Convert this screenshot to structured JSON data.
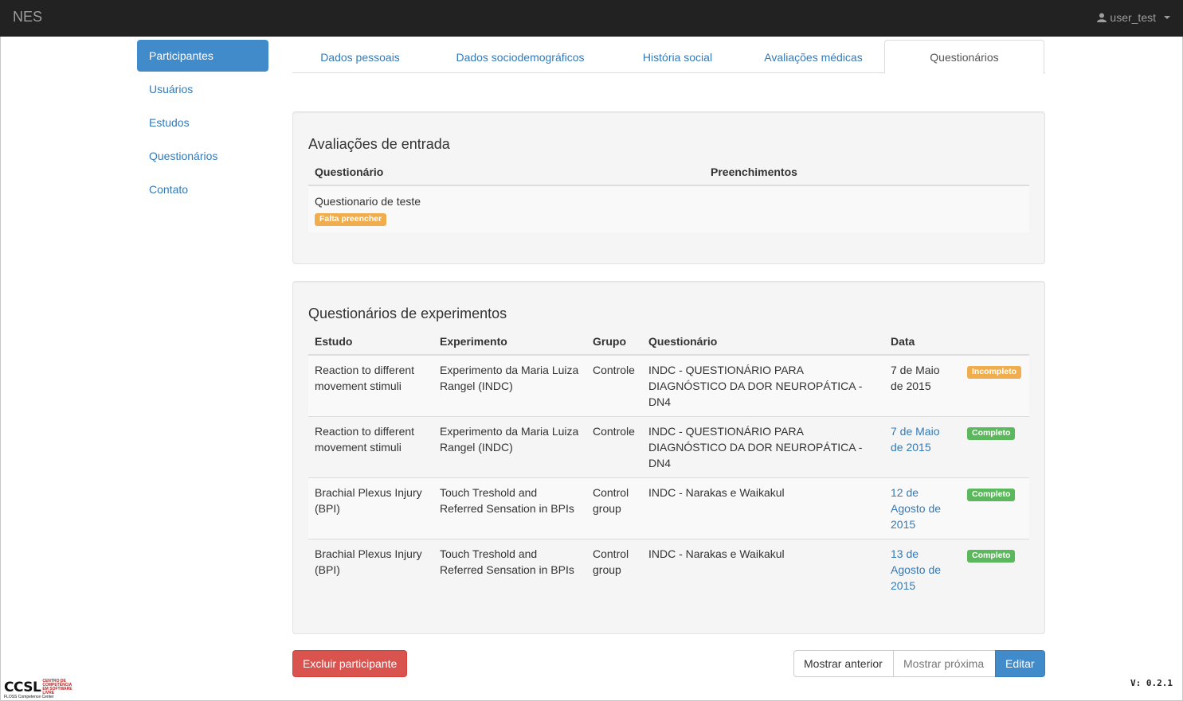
{
  "navbar": {
    "brand": "NES",
    "user": "user_test"
  },
  "sidebar": {
    "items": [
      "Participantes",
      "Usuários",
      "Estudos",
      "Questionários",
      "Contato"
    ]
  },
  "tabs": [
    "Dados pessoais",
    "Dados sociodemográficos",
    "História social",
    "Avaliações médicas",
    "Questionários"
  ],
  "entry": {
    "title": "Avaliações de entrada",
    "headers": [
      "Questionário",
      "Preenchimentos"
    ],
    "row": {
      "name": "Questionario de teste",
      "badge": "Falta preencher"
    }
  },
  "experiments": {
    "title": "Questionários de experimentos",
    "headers": [
      "Estudo",
      "Experimento",
      "Grupo",
      "Questionário",
      "Data"
    ],
    "rows": [
      {
        "estudo": "Reaction to different movement stimuli",
        "experimento": "Experimento da Maria Luiza Rangel (INDC)",
        "grupo": "Controle",
        "questionario": "INDC - QUESTIONÁRIO PARA DIAGNÓSTICO DA DOR NEUROPÁTICA - DN4",
        "data": "7 de Maio de 2015",
        "status": "Incompleto"
      },
      {
        "estudo": "Reaction to different movement stimuli",
        "experimento": "Experimento da Maria Luiza Rangel (INDC)",
        "grupo": "Controle",
        "questionario": "INDC - QUESTIONÁRIO PARA DIAGNÓSTICO DA DOR NEUROPÁTICA - DN4",
        "data": "7 de Maio de 2015",
        "status": "Completo"
      },
      {
        "estudo": "Brachial Plexus Injury (BPI)",
        "experimento": "Touch Treshold and Referred Sensation in BPIs",
        "grupo": "Control group",
        "questionario": "INDC - Narakas e Waikakul",
        "data": "12 de Agosto de 2015",
        "status": "Completo"
      },
      {
        "estudo": "Brachial Plexus Injury (BPI)",
        "experimento": "Touch Treshold and Referred Sensation in BPIs",
        "grupo": "Control group",
        "questionario": "INDC - Narakas e Waikakul",
        "data": "13 de Agosto de 2015",
        "status": "Completo"
      }
    ]
  },
  "buttons": {
    "delete": "Excluir participante",
    "previous": "Mostrar anterior",
    "next": "Mostrar próxima",
    "edit": "Editar"
  },
  "footer": {
    "logo": "CCSL",
    "logo_small": "CENTRO DE COMPETÊNCIA EM SOFTWARE LIVRE",
    "logo_sub": "FLOSS Competence Center",
    "version": "V: 0.2.1"
  },
  "colors": {
    "primary": "#428bca",
    "danger": "#d9534f",
    "warning": "#f0ad4e",
    "success": "#5cb85c",
    "navbar": "#222222"
  }
}
